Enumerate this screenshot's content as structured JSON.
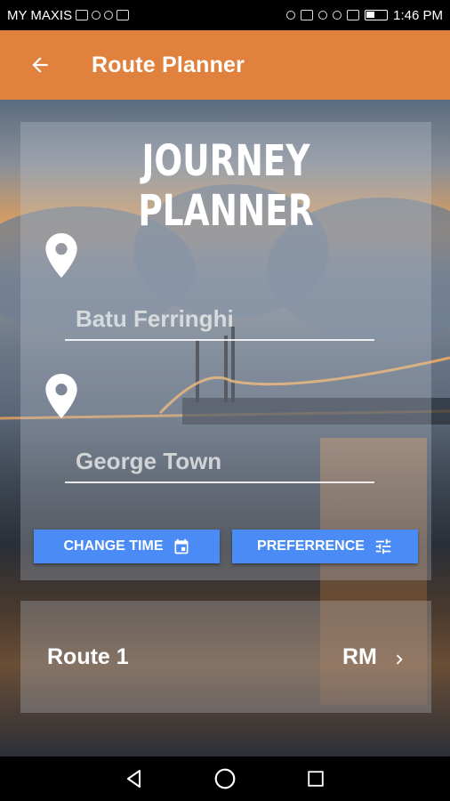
{
  "status_bar": {
    "carrier": "MY MAXIS",
    "time": "1:46 PM"
  },
  "app_bar": {
    "title": "Route Planner",
    "back_icon": "arrow-left-icon"
  },
  "planner": {
    "heading": "JOURNEY PLANNER",
    "origin": {
      "value": "Batu Ferringhi",
      "icon": "location-pin-icon"
    },
    "destination": {
      "value": "George Town",
      "icon": "location-pin-icon"
    },
    "change_time_label": "CHANGE TIME",
    "change_time_icon": "calendar-icon",
    "preference_label": "PREFERRENCE",
    "preference_icon": "sliders-icon"
  },
  "route": {
    "name": "Route 1",
    "price": "RM",
    "chevron_icon": "chevron-right-icon"
  },
  "colors": {
    "app_bar": "#e0813d",
    "button": "#4a8bf5"
  }
}
